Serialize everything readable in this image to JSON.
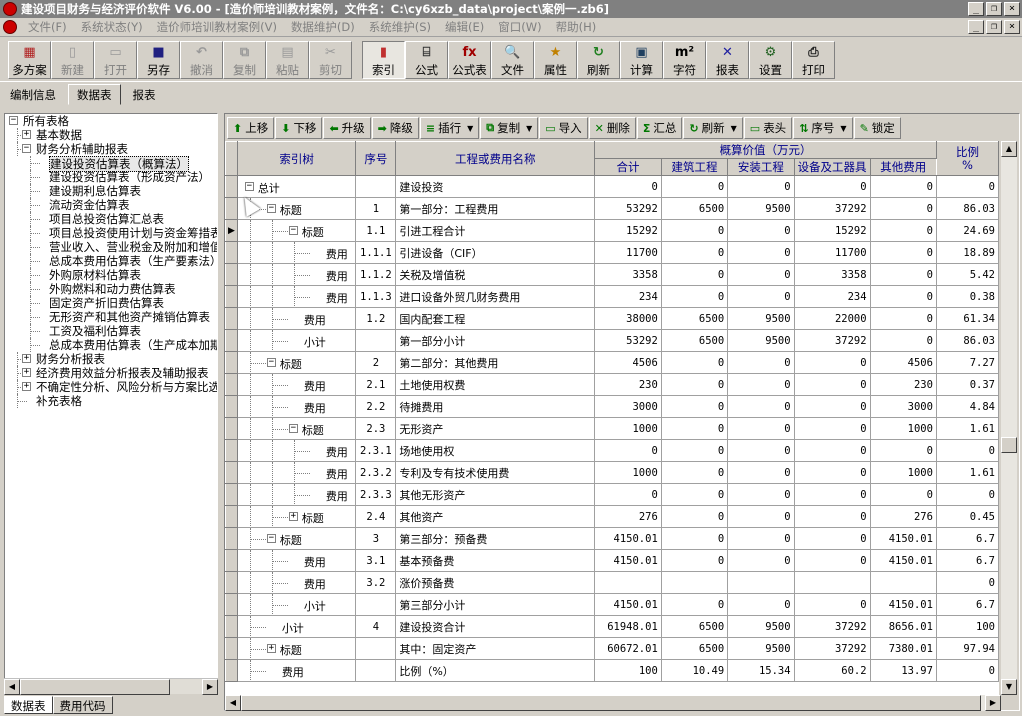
{
  "titlebar": {
    "title": "建设项目财务与经济评价软件 V6.00 - [造价师培训教材案例，文件名：C:\\cy6xzb_data\\project\\案例一.zb6]",
    "minimize": "_",
    "restore": "❐",
    "close": "×"
  },
  "menu": [
    {
      "label": "文件(F)"
    },
    {
      "label": "系统状态(Y)"
    },
    {
      "label": "造价师培训教材案例(V)"
    },
    {
      "label": "数据维护(D)"
    },
    {
      "label": "系统维护(S)"
    },
    {
      "label": "编辑(E)"
    },
    {
      "label": "窗口(W)"
    },
    {
      "label": "帮助(H)"
    }
  ],
  "toolbar": {
    "group1": [
      {
        "label": "多方案",
        "icon": "multi-scheme-icon",
        "glyph": "▦",
        "color": "#b02020",
        "enabled": true
      },
      {
        "label": "新建",
        "icon": "new-file-icon",
        "glyph": "▯",
        "color": "#999",
        "enabled": false
      },
      {
        "label": "打开",
        "icon": "open-folder-icon",
        "glyph": "▭",
        "color": "#999",
        "enabled": false
      },
      {
        "label": "另存",
        "icon": "save-icon",
        "glyph": "■",
        "color": "#202080",
        "enabled": true
      },
      {
        "label": "撤消",
        "icon": "undo-icon",
        "glyph": "↶",
        "color": "#999",
        "enabled": false
      },
      {
        "label": "复制",
        "icon": "copy-icon",
        "glyph": "⧉",
        "color": "#999",
        "enabled": false
      },
      {
        "label": "粘贴",
        "icon": "paste-icon",
        "glyph": "▤",
        "color": "#999",
        "enabled": false
      },
      {
        "label": "剪切",
        "icon": "cut-icon",
        "glyph": "✂",
        "color": "#999",
        "enabled": false
      }
    ],
    "group2": [
      {
        "label": "索引",
        "icon": "index-icon",
        "glyph": "▮",
        "color": "#c03030",
        "enabled": true,
        "pressed": true
      },
      {
        "label": "公式",
        "icon": "formula-icon",
        "glyph": "⌸",
        "color": "#303030",
        "enabled": true
      },
      {
        "label": "公式表",
        "icon": "formula-table-icon",
        "glyph": "fx",
        "color": "#a00000",
        "enabled": true
      },
      {
        "label": "文件",
        "icon": "file-search-icon",
        "glyph": "🔍",
        "color": "#204080",
        "enabled": true
      },
      {
        "label": "属性",
        "icon": "properties-icon",
        "glyph": "★",
        "color": "#c08000",
        "enabled": true
      },
      {
        "label": "刷新",
        "icon": "refresh-icon",
        "glyph": "↻",
        "color": "#208020",
        "enabled": true
      },
      {
        "label": "计算",
        "icon": "calculator-icon",
        "glyph": "▣",
        "color": "#204060",
        "enabled": true
      },
      {
        "label": "字符",
        "icon": "char-icon",
        "glyph": "m²",
        "color": "#000",
        "enabled": true
      },
      {
        "label": "报表",
        "icon": "report-icon",
        "glyph": "✕",
        "color": "#2020a0",
        "enabled": true
      },
      {
        "label": "设置",
        "icon": "settings-icon",
        "glyph": "⚙",
        "color": "#206020",
        "enabled": true
      },
      {
        "label": "打印",
        "icon": "printer-icon",
        "glyph": "⎙",
        "color": "#202020",
        "enabled": true
      }
    ]
  },
  "tabs": [
    {
      "label": "编制信息",
      "active": false
    },
    {
      "label": "数据表",
      "active": true
    },
    {
      "label": "报表",
      "active": false
    }
  ],
  "tree": [
    {
      "label": "所有表格",
      "level": 0,
      "expander": "−"
    },
    {
      "label": "基本数据",
      "level": 1,
      "expander": "+"
    },
    {
      "label": "财务分析辅助报表",
      "level": 1,
      "expander": "−"
    },
    {
      "label": "建设投资估算表（概算法）",
      "level": 2,
      "selected": true
    },
    {
      "label": "建设投资估算表（形成资产法）",
      "level": 2
    },
    {
      "label": "建设期利息估算表",
      "level": 2
    },
    {
      "label": "流动资金估算表",
      "level": 2
    },
    {
      "label": "项目总投资估算汇总表",
      "level": 2
    },
    {
      "label": "项目总投资使用计划与资金筹措表",
      "level": 2
    },
    {
      "label": "营业收入、营业税金及附加和增值税估算表",
      "level": 2
    },
    {
      "label": "总成本费用估算表（生产要素法）",
      "level": 2
    },
    {
      "label": "外购原材料估算表",
      "level": 2
    },
    {
      "label": "外购燃料和动力费估算表",
      "level": 2
    },
    {
      "label": "固定资产折旧费估算表",
      "level": 2
    },
    {
      "label": "无形资产和其他资产摊销估算表",
      "level": 2
    },
    {
      "label": "工资及福利估算表",
      "level": 2
    },
    {
      "label": "总成本费用估算表（生产成本加期间费用法）",
      "level": 2
    },
    {
      "label": "财务分析报表",
      "level": 1,
      "expander": "+"
    },
    {
      "label": "经济费用效益分析报表及辅助报表",
      "level": 1,
      "expander": "+"
    },
    {
      "label": "不确定性分析、风险分析与方案比选",
      "level": 1,
      "expander": "+"
    },
    {
      "label": "补充表格",
      "level": 1
    }
  ],
  "bottom_tabs": [
    {
      "label": "数据表",
      "active": true
    },
    {
      "label": "费用代码",
      "active": false
    }
  ],
  "grid_toolbar": [
    {
      "label": "上移",
      "icon": "up-arrow-icon",
      "glyph": "⬆"
    },
    {
      "label": "下移",
      "icon": "down-arrow-icon",
      "glyph": "⬇"
    },
    {
      "label": "升级",
      "icon": "left-arrow-icon",
      "glyph": "⬅"
    },
    {
      "label": "降级",
      "icon": "right-arrow-icon",
      "glyph": "➡"
    },
    {
      "label": "插行",
      "icon": "insert-row-icon",
      "glyph": "≡",
      "dropdown": true
    },
    {
      "label": "复制",
      "icon": "copy-row-icon",
      "glyph": "⧉",
      "dropdown": true
    },
    {
      "label": "导入",
      "icon": "import-icon",
      "glyph": "▭"
    },
    {
      "label": "删除",
      "icon": "delete-icon",
      "glyph": "✕"
    },
    {
      "label": "汇总",
      "icon": "sum-icon",
      "glyph": "Σ"
    },
    {
      "label": "刷新",
      "icon": "refresh-grid-icon",
      "glyph": "↻",
      "dropdown": true
    },
    {
      "label": "表头",
      "icon": "header-icon",
      "glyph": "▭"
    },
    {
      "label": "序号",
      "icon": "sort-number-icon",
      "glyph": "⇅",
      "dropdown": true
    },
    {
      "label": "锁定",
      "icon": "lock-icon",
      "glyph": "✎"
    }
  ],
  "grid": {
    "headers": {
      "index": "索引树",
      "seq": "序号",
      "name": "工程或费用名称",
      "group": "概算价值（万元）",
      "total": "合计",
      "building": "建筑工程",
      "install": "安装工程",
      "equipment": "设备及工器具",
      "other": "其他费用",
      "ratio": "比例\n%"
    },
    "rows": [
      {
        "tree": "总计",
        "level": 0,
        "expander": "−",
        "seq": "",
        "name": "建设投资",
        "total": "0",
        "building": "0",
        "install": "0",
        "equipment": "0",
        "other": "0",
        "ratio": "0"
      },
      {
        "tree": "标题",
        "level": 1,
        "expander": "−",
        "seq": "1",
        "name": "第一部分：工程费用",
        "total": "53292",
        "building": "6500",
        "install": "9500",
        "equipment": "37292",
        "other": "0",
        "ratio": "86.03"
      },
      {
        "tree": "标题",
        "level": 2,
        "expander": "−",
        "seq": "1.1",
        "name": "引进工程合计",
        "total": "15292",
        "building": "0",
        "install": "0",
        "equipment": "15292",
        "other": "0",
        "ratio": "24.69",
        "current": true
      },
      {
        "tree": "费用",
        "level": 3,
        "seq": "1.1.1",
        "name": "引进设备（CIF）",
        "total": "11700",
        "building": "0",
        "install": "0",
        "equipment": "11700",
        "other": "0",
        "ratio": "18.89"
      },
      {
        "tree": "费用",
        "level": 3,
        "seq": "1.1.2",
        "name": "关税及增值税",
        "total": "3358",
        "building": "0",
        "install": "0",
        "equipment": "3358",
        "other": "0",
        "ratio": "5.42"
      },
      {
        "tree": "费用",
        "level": 3,
        "seq": "1.1.3",
        "name": "进口设备外贸几财务费用",
        "total": "234",
        "building": "0",
        "install": "0",
        "equipment": "234",
        "other": "0",
        "ratio": "0.38"
      },
      {
        "tree": "费用",
        "level": 2,
        "seq": "1.2",
        "name": "国内配套工程",
        "total": "38000",
        "building": "6500",
        "install": "9500",
        "equipment": "22000",
        "other": "0",
        "ratio": "61.34"
      },
      {
        "tree": "小计",
        "level": 2,
        "seq": "",
        "name": "第一部分小计",
        "total": "53292",
        "building": "6500",
        "install": "9500",
        "equipment": "37292",
        "other": "0",
        "ratio": "86.03"
      },
      {
        "tree": "标题",
        "level": 1,
        "expander": "−",
        "seq": "2",
        "name": "第二部分：其他费用",
        "total": "4506",
        "building": "0",
        "install": "0",
        "equipment": "0",
        "other": "4506",
        "ratio": "7.27"
      },
      {
        "tree": "费用",
        "level": 2,
        "seq": "2.1",
        "name": "土地使用权费",
        "total": "230",
        "building": "0",
        "install": "0",
        "equipment": "0",
        "other": "230",
        "ratio": "0.37"
      },
      {
        "tree": "费用",
        "level": 2,
        "seq": "2.2",
        "name": "待摊费用",
        "total": "3000",
        "building": "0",
        "install": "0",
        "equipment": "0",
        "other": "3000",
        "ratio": "4.84"
      },
      {
        "tree": "标题",
        "level": 2,
        "expander": "−",
        "seq": "2.3",
        "name": "无形资产",
        "total": "1000",
        "building": "0",
        "install": "0",
        "equipment": "0",
        "other": "1000",
        "ratio": "1.61"
      },
      {
        "tree": "费用",
        "level": 3,
        "seq": "2.3.1",
        "name": "场地使用权",
        "total": "0",
        "building": "0",
        "install": "0",
        "equipment": "0",
        "other": "0",
        "ratio": "0"
      },
      {
        "tree": "费用",
        "level": 3,
        "seq": "2.3.2",
        "name": "专利及专有技术使用费",
        "total": "1000",
        "building": "0",
        "install": "0",
        "equipment": "0",
        "other": "1000",
        "ratio": "1.61"
      },
      {
        "tree": "费用",
        "level": 3,
        "seq": "2.3.3",
        "name": "其他无形资产",
        "total": "0",
        "building": "0",
        "install": "0",
        "equipment": "0",
        "other": "0",
        "ratio": "0"
      },
      {
        "tree": "标题",
        "level": 2,
        "expander": "+",
        "seq": "2.4",
        "name": "其他资产",
        "total": "276",
        "building": "0",
        "install": "0",
        "equipment": "0",
        "other": "276",
        "ratio": "0.45"
      },
      {
        "tree": "标题",
        "level": 1,
        "expander": "−",
        "seq": "3",
        "name": "第三部分：预备费",
        "total": "4150.01",
        "building": "0",
        "install": "0",
        "equipment": "0",
        "other": "4150.01",
        "ratio": "6.7"
      },
      {
        "tree": "费用",
        "level": 2,
        "seq": "3.1",
        "name": "基本预备费",
        "total": "4150.01",
        "building": "0",
        "install": "0",
        "equipment": "0",
        "other": "4150.01",
        "ratio": "6.7"
      },
      {
        "tree": "费用",
        "level": 2,
        "seq": "3.2",
        "name": "涨价预备费",
        "total": "",
        "building": "",
        "install": "",
        "equipment": "",
        "other": "",
        "ratio": "0"
      },
      {
        "tree": "小计",
        "level": 2,
        "seq": "",
        "name": "第三部分小计",
        "total": "4150.01",
        "building": "0",
        "install": "0",
        "equipment": "0",
        "other": "4150.01",
        "ratio": "6.7"
      },
      {
        "tree": "小计",
        "level": 1,
        "seq": "4",
        "name": "建设投资合计",
        "total": "61948.01",
        "building": "6500",
        "install": "9500",
        "equipment": "37292",
        "other": "8656.01",
        "ratio": "100"
      },
      {
        "tree": "标题",
        "level": 1,
        "expander": "+",
        "seq": "",
        "name": "其中：固定资产",
        "total": "60672.01",
        "building": "6500",
        "install": "9500",
        "equipment": "37292",
        "other": "7380.01",
        "ratio": "97.94"
      },
      {
        "tree": "费用",
        "level": 1,
        "seq": "",
        "name": "比例（%）",
        "total": "100",
        "building": "10.49",
        "install": "15.34",
        "equipment": "60.2",
        "other": "13.97",
        "ratio": "0"
      }
    ]
  },
  "colors": {
    "face": "#d4d0c8",
    "header_text": "#00008b",
    "title_inactive": "#808080"
  }
}
